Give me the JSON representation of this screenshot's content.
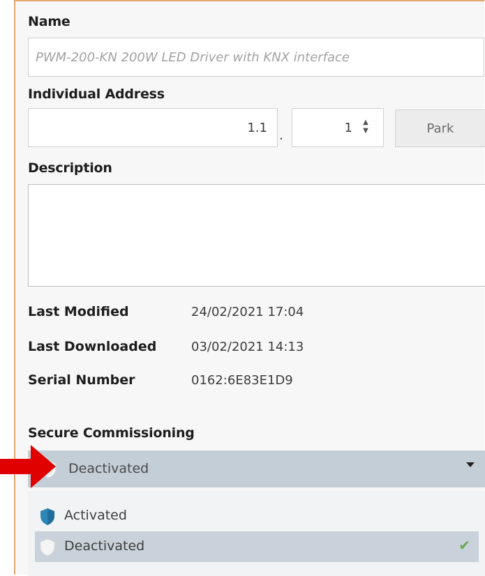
{
  "fields": {
    "name_label": "Name",
    "name_value": "PWM-200-KN 200W LED Driver with KNX interface",
    "address_label": "Individual Address",
    "address_line": "1.1",
    "address_separator": ".",
    "address_device": "1",
    "park_label": "Park",
    "description_label": "Description",
    "description_value": ""
  },
  "info": {
    "rows": [
      {
        "key": "Last Modified",
        "value": "24/02/2021 17:04"
      },
      {
        "key": "Last Downloaded",
        "value": "03/02/2021 14:13"
      },
      {
        "key": "Serial Number",
        "value": "0162:6E83E1D9"
      }
    ]
  },
  "secure_commissioning": {
    "label": "Secure Commissioning",
    "selected": "Deactivated",
    "options": [
      {
        "label": "Activated",
        "icon": "shield-activated-icon",
        "selected": false
      },
      {
        "label": "Deactivated",
        "icon": "shield-deactivated-icon",
        "selected": true
      }
    ]
  },
  "colors": {
    "accent_border": "#e2a86b",
    "dropdown_bg": "#c4ced7",
    "selected_option_bg": "#c9d2da",
    "shield_active": "#2f86b8",
    "check": "#6aa84f",
    "annotation_arrow": "#e00000"
  }
}
